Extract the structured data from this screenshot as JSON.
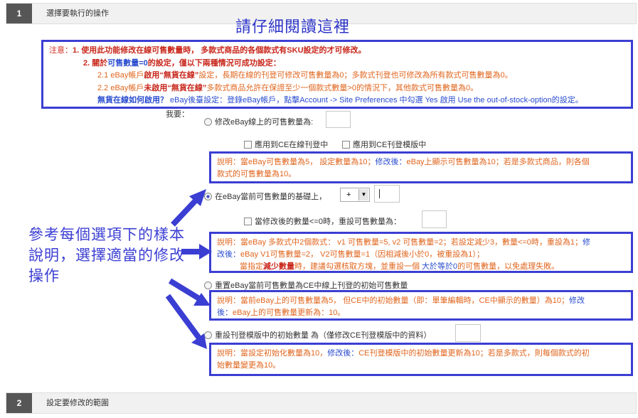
{
  "step1": {
    "num": "1",
    "title": "選擇要執行的操作"
  },
  "step2": {
    "num": "2",
    "title": "設定要修改的範圍"
  },
  "annotation": {
    "title": "請仔細閱讀這裡",
    "left_note": "參考每個選項下的樣本說明，選擇適當的修改操作",
    "color": "#3b3ed2"
  },
  "notice": {
    "prefix": "注意：",
    "line1": "1. 使用此功能修改在線可售數量時， 多款式商品的各個款式有SKU設定的才可修改。",
    "line2_a": "2. 關於",
    "line2_b": "可售數量=0",
    "line2_c": "的設定，僅以下兩種情況可成功設定：",
    "line3_a": "2.1 eBay帳戶",
    "line3_b": "啟用",
    "line3_c": "“無貨在線”",
    "line3_d": "設定，長期在線的刊登可修改可售數量為0；多款式刊登也可修改為所有款式可售數量為0。",
    "line4_a": "2.2 eBay帳戶",
    "line4_b": "未啟用",
    "line4_c": "“無貨在線”",
    "line4_d": "多款式商品允許在保證至少一個款式數量>0的情況下，其他款式可售數量為0。",
    "line5_a": "無貨在線如何啟用？",
    "line5_b": " eBay後臺設定：登錄eBay帳戶，點擊Account -> Site Preferences 中勾選 Yes 啟用 Use the out-of-stock-option的設定。"
  },
  "form": {
    "me_label": "我要：",
    "opt1_label": "修改eBay線上的可售數量為:",
    "cb_online": "應用到CE在線刊登中",
    "cb_template": "應用到CE刊登模版中",
    "desc1_a": "說明：當eBay可售數量為5， 設定數量為10；",
    "desc1_b": "修改後：",
    "desc1_c": "eBay上顯示可售數量為10；若是多款式商品，則各個",
    "desc1_d": "款式的可售數量為10。",
    "opt2_label": "在eBay當前可售數量的基礎上，",
    "opt2_select": "+",
    "cb_zero": "當修改後的數量<=0時，重設可售數量為：",
    "desc2_a": "說明：當eBay 多款式中2個款式： v1 可售數量=5, v2 可售數量=2；若設定減少3，數量<=0時，重設為1；",
    "desc2_b": "修",
    "desc2_c": "改後：",
    "desc2_d": "eBay V1可售數量=2， V2可售數量=1（因相減後小於0，被重設為1）；",
    "desc2_e_a": "當指定",
    "desc2_e_b": "減少數量",
    "desc2_e_c": "時，建議勾選核取方塊，並重設一個",
    "desc2_e_d": " 大於等於0",
    "desc2_e_e": "的可售數量，以免處理失敗。",
    "opt3_label": "重置eBay當前可售數量為CE中線上刊登的初始可售數量",
    "desc3_a": "說明：當前eBay上的可售數量為5， 但CE中的初始數量（即：單筆編輯時，CE中顯示的數量）為10；",
    "desc3_b": "修改",
    "desc3_c": "後：",
    "desc3_d": "eBay上的可售數量更新為：10。",
    "opt4_label": "重設刊登模版中的初始數量 為（僅修改CE刊登模版中的資料）",
    "desc4_a": "說明：當設定初始化數量為10，",
    "desc4_b": "修改後：",
    "desc4_c": "CE刊登模版中的初始數量更新為10；若是多款式，則每個款式的初",
    "desc4_d": "始數量變更為10。"
  }
}
